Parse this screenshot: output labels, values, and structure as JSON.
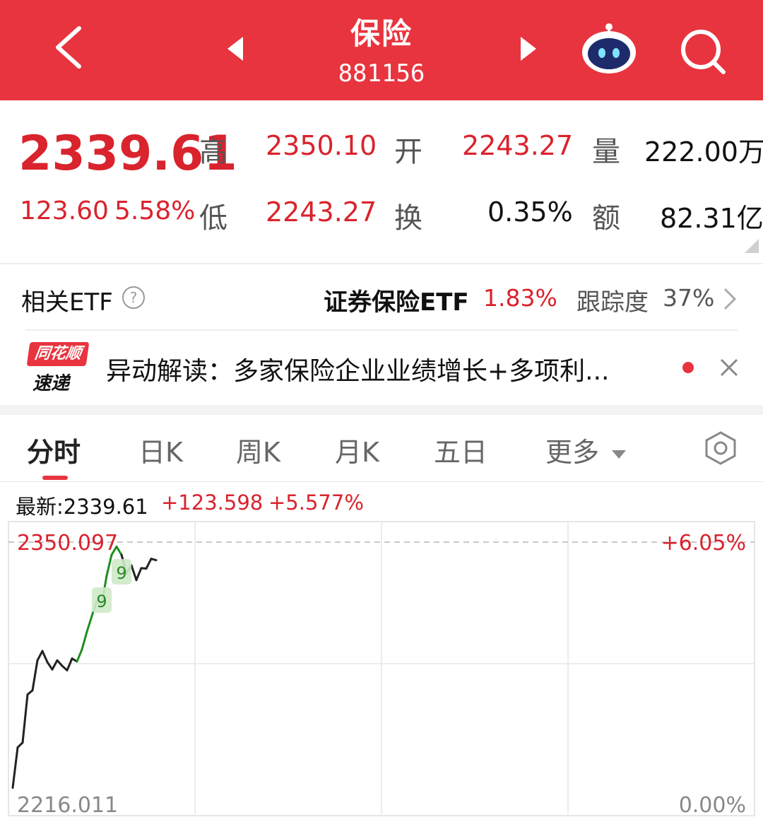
{
  "header": {
    "title": "保险",
    "code": "881156",
    "bg_color": "#e8343f",
    "icons": [
      "back-arrow-icon",
      "prev-triangle-icon",
      "next-triangle-icon",
      "robot-assistant-icon",
      "search-icon"
    ]
  },
  "quote": {
    "price": "2339.61",
    "change": "123.60",
    "change_pct": "5.58%",
    "high_label": "高",
    "high": "2350.10",
    "open_label": "开",
    "open": "2243.27",
    "volume_label": "量",
    "volume": "222.00万",
    "low_label": "低",
    "low": "2243.27",
    "turnover_label": "换",
    "turnover": "0.35%",
    "amount_label": "额",
    "amount": "82.31亿"
  },
  "etf": {
    "label": "相关ETF",
    "help_icon": "question-circle-icon",
    "name": "证券保险ETF",
    "pct": "1.83%",
    "track_label": "跟踪度",
    "track_value": "37%",
    "chevron_icon": "chevron-right-icon"
  },
  "news": {
    "logo_top": "同花顺",
    "logo_bottom": "速递",
    "text": "异动解读：多家保险企业业绩增长+多项利...",
    "close_icon": "close-icon"
  },
  "tabs": {
    "items": [
      "分时",
      "日K",
      "周K",
      "月K",
      "五日",
      "更多"
    ],
    "active": 0,
    "settings_icon": "hexagon-settings-icon"
  },
  "latest": {
    "label": "最新:2339.61",
    "change": "+123.598",
    "change_pct": "+5.577%"
  },
  "chart_data": {
    "type": "line",
    "y_top_label": "2350.097",
    "y_bottom_label": "2216.011",
    "right_top_label": "+6.05%",
    "right_bottom_label": "0.00%",
    "y_range": [
      2216.011,
      2350.097
    ],
    "markers": [
      "9",
      "9"
    ],
    "grid": true,
    "series": [
      {
        "color_main": "#222222",
        "color_highlight": "#1f8f1f",
        "values": [
          2226.5,
          2246.8,
          2249.2,
          2273.4,
          2275.5,
          2290.6,
          2295.3,
          2289.7,
          2286.0,
          2290.6,
          2287.8,
          2285.6,
          2291.5,
          2290.0,
          2296.1,
          2305.0,
          2312.9,
          2320.4,
          2318.8,
          2333.2,
          2343.7,
          2347.8,
          2343.7,
          2334.5,
          2338.4,
          2331.0,
          2337.0,
          2336.8,
          2341.7,
          2341.0
        ],
        "highlight_range": [
          13,
          22
        ]
      }
    ]
  }
}
